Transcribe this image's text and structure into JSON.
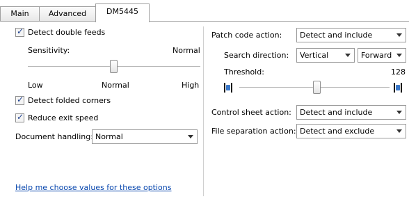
{
  "tabs": [
    {
      "label": "Main"
    },
    {
      "label": "Advanced"
    },
    {
      "label": "DM5445"
    }
  ],
  "left": {
    "detect_double_feeds": {
      "label": "Detect double feeds",
      "checked": true
    },
    "sensitivity": {
      "label": "Sensitivity:",
      "value": "Normal",
      "low": "Low",
      "mid": "Normal",
      "high": "High"
    },
    "detect_folded_corners": {
      "label": "Detect folded corners",
      "checked": true
    },
    "reduce_exit_speed": {
      "label": "Reduce exit speed",
      "checked": true
    },
    "document_handling": {
      "label": "Document handling:",
      "value": "Normal"
    }
  },
  "right": {
    "patch_code_action": {
      "label": "Patch code action:",
      "value": "Detect and include"
    },
    "search_direction": {
      "label": "Search direction:",
      "value1": "Vertical",
      "value2": "Forward"
    },
    "threshold": {
      "label": "Threshold:",
      "value": "128"
    },
    "control_sheet_action": {
      "label": "Control sheet action:",
      "value": "Detect and include"
    },
    "file_separation_action": {
      "label": "File separation action:",
      "value": "Detect and exclude"
    }
  },
  "help_link": "Help me choose values for these options",
  "colors": {
    "link": "#0645ad",
    "check": "#1c3f8f",
    "threshold_icon": "#3a78c9"
  }
}
